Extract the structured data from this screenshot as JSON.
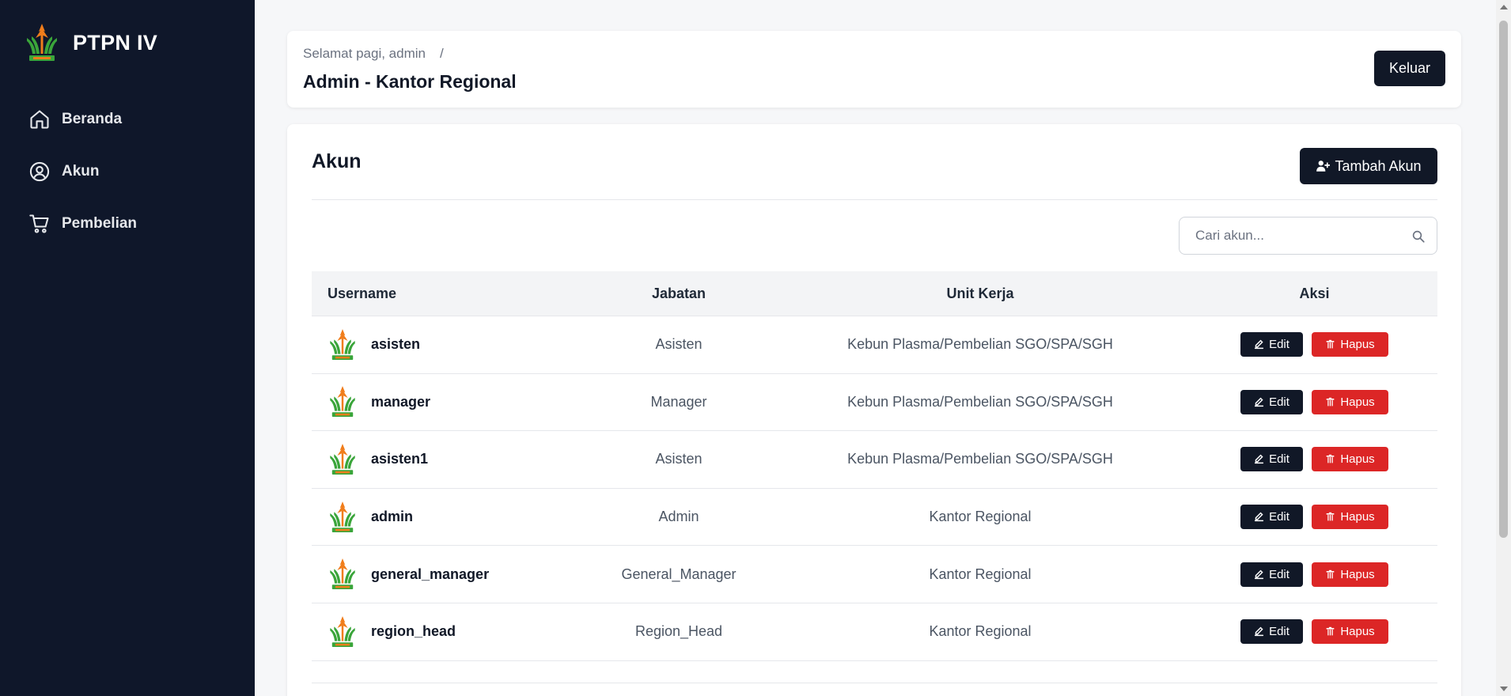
{
  "brand": {
    "name": "PTPN IV"
  },
  "sidebar": {
    "items": [
      {
        "label": "Beranda",
        "icon": "home-icon"
      },
      {
        "label": "Akun",
        "icon": "user-circle-icon"
      },
      {
        "label": "Pembelian",
        "icon": "cart-icon"
      }
    ]
  },
  "header": {
    "greeting": "Selamat pagi, admin",
    "separator": "/",
    "title": "Admin - Kantor Regional",
    "logout_label": "Keluar"
  },
  "main": {
    "title": "Akun",
    "add_label": "Tambah Akun",
    "search_placeholder": "Cari akun...",
    "columns": [
      "Username",
      "Jabatan",
      "Unit Kerja",
      "Aksi"
    ],
    "edit_label": "Edit",
    "delete_label": "Hapus",
    "rows": [
      {
        "username": "asisten",
        "jabatan": "Asisten",
        "unit": "Kebun Plasma/Pembelian SGO/SPA/SGH"
      },
      {
        "username": "manager",
        "jabatan": "Manager",
        "unit": "Kebun Plasma/Pembelian SGO/SPA/SGH"
      },
      {
        "username": "asisten1",
        "jabatan": "Asisten",
        "unit": "Kebun Plasma/Pembelian SGO/SPA/SGH"
      },
      {
        "username": "admin",
        "jabatan": "Admin",
        "unit": "Kantor Regional"
      },
      {
        "username": "general_manager",
        "jabatan": "General_Manager",
        "unit": "Kantor Regional"
      },
      {
        "username": "region_head",
        "jabatan": "Region_Head",
        "unit": "Kantor Regional"
      }
    ]
  },
  "colors": {
    "sidebar_bg": "#0f172a",
    "primary_button": "#111827",
    "danger_button": "#dc2626",
    "logo_orange": "#f07d1b",
    "logo_green": "#3aa53a"
  }
}
